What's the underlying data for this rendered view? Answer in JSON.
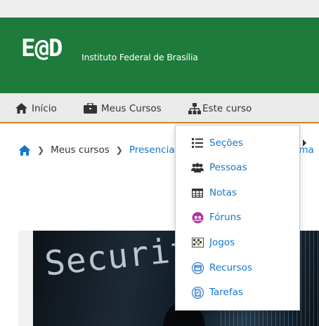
{
  "header": {
    "logo_mark": "E@D",
    "institution": "Instituto Federal de Brasília"
  },
  "nav": {
    "home": "Início",
    "my_courses": "Meus Cursos",
    "this_course": "Este curso"
  },
  "breadcrumb": {
    "my_courses": "Meus cursos",
    "category": "Presenciais",
    "trailing": "rma"
  },
  "banner": {
    "word": "Security"
  },
  "course_menu": {
    "items": [
      {
        "label": "Seções",
        "icon": "list-icon"
      },
      {
        "label": "Pessoas",
        "icon": "users-icon"
      },
      {
        "label": "Notas",
        "icon": "table-icon"
      },
      {
        "label": "Fóruns",
        "icon": "forum-icon"
      },
      {
        "label": "Jogos",
        "icon": "game-icon"
      },
      {
        "label": "Recursos",
        "icon": "resource-icon"
      },
      {
        "label": "Tarefas",
        "icon": "assignment-icon"
      }
    ]
  },
  "colors": {
    "header_bg": "#1e7b3c",
    "nav_bg": "#eaeaea",
    "nav_accent": "#d9822b",
    "link": "#1177d1"
  }
}
